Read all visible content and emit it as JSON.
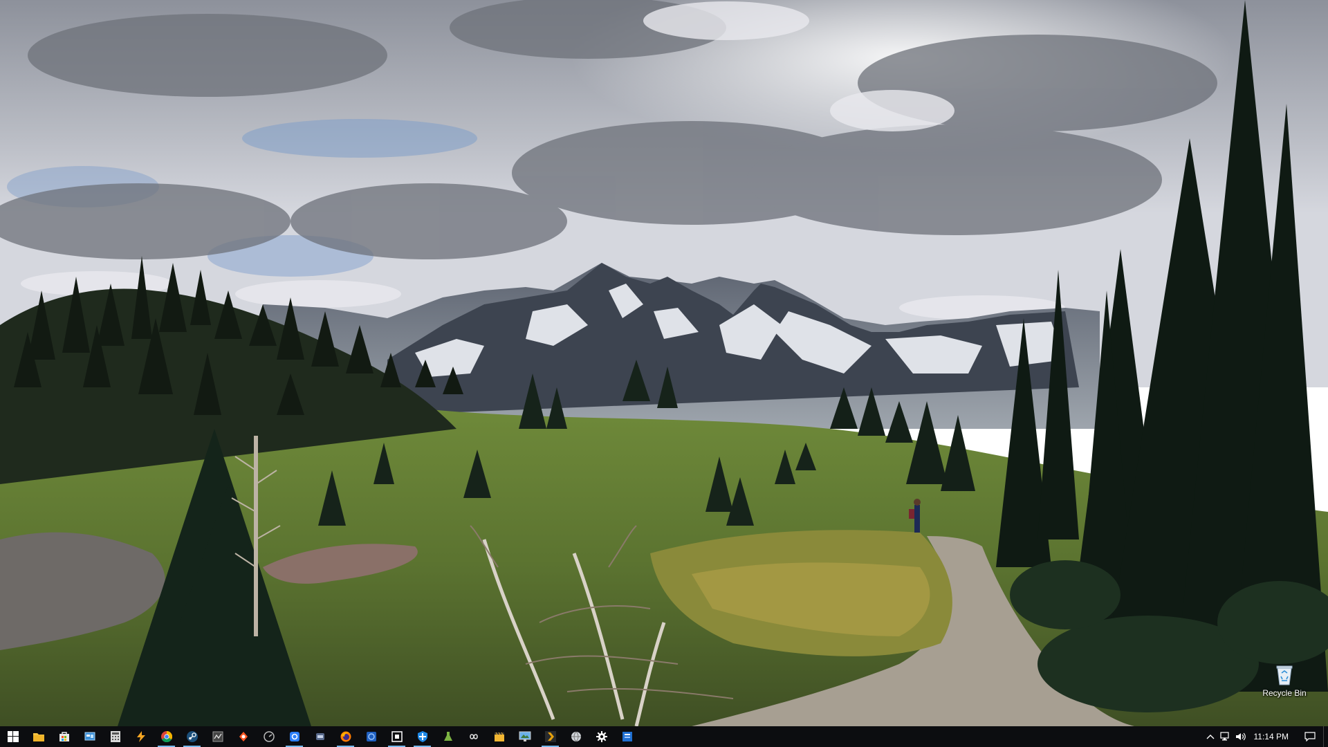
{
  "desktop": {
    "wallpaper": "mountain-trail-landscape",
    "icons": [
      {
        "label": "Recycle Bin",
        "icon": "recycle-bin-icon"
      }
    ]
  },
  "taskbar": {
    "background": "#0c0d10",
    "accent": "#76b9ed",
    "pinned": [
      {
        "name": "start-button",
        "icon": "windows-logo-icon"
      },
      {
        "name": "file-explorer-button",
        "icon": "folder-icon"
      },
      {
        "name": "store-button",
        "icon": "store-bag-icon"
      },
      {
        "name": "control-panel-button",
        "icon": "control-panel-icon"
      },
      {
        "name": "calculator-button",
        "icon": "calculator-icon"
      },
      {
        "name": "winamp-button",
        "icon": "lightning-icon"
      },
      {
        "name": "chrome-button",
        "icon": "chrome-icon"
      },
      {
        "name": "steam-button",
        "icon": "steam-icon"
      },
      {
        "name": "app-button-9",
        "icon": "wave-icon"
      },
      {
        "name": "app-button-10",
        "icon": "orange-diamond-icon"
      },
      {
        "name": "app-button-11",
        "icon": "gauge-icon"
      },
      {
        "name": "app-button-12",
        "icon": "blue-square-icon"
      },
      {
        "name": "app-button-13",
        "icon": "speaker-icon"
      },
      {
        "name": "firefox-button",
        "icon": "firefox-icon"
      },
      {
        "name": "app-button-15",
        "icon": "blue-circle-icon"
      },
      {
        "name": "app-button-16",
        "icon": "square-target-icon"
      },
      {
        "name": "defender-button",
        "icon": "shield-icon"
      },
      {
        "name": "app-button-18",
        "icon": "flask-icon"
      },
      {
        "name": "app-button-19",
        "icon": "infinity-icon"
      },
      {
        "name": "app-button-20",
        "icon": "clapperboard-icon"
      },
      {
        "name": "app-button-21",
        "icon": "monitor-icon"
      },
      {
        "name": "plex-button",
        "icon": "play-chevron-icon"
      },
      {
        "name": "app-button-23",
        "icon": "globe-icon"
      },
      {
        "name": "settings-button",
        "icon": "gear-icon"
      },
      {
        "name": "app-button-25",
        "icon": "blue-app-icon"
      }
    ],
    "tray": {
      "chevron_icon": "chevron-up-icon",
      "network_icon": "network-icon",
      "volume_icon": "volume-icon",
      "time": "11:14 PM",
      "notification_icon": "action-center-icon"
    }
  }
}
